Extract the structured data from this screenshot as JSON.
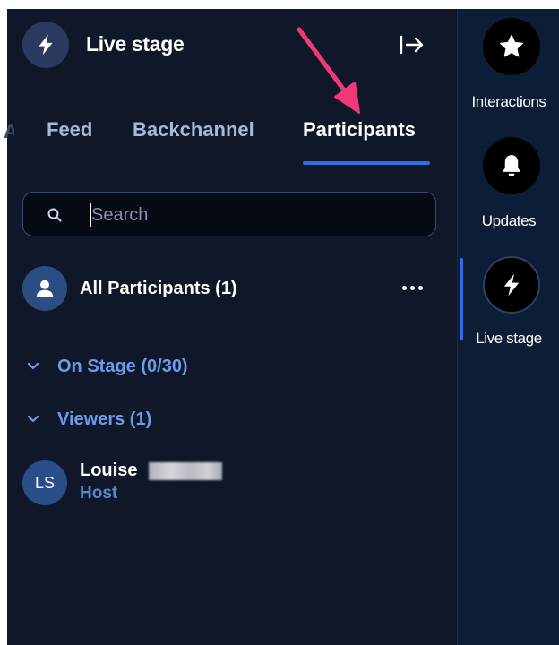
{
  "header": {
    "title": "Live stage",
    "avatar_icon": "lightning-icon",
    "collapse_icon": "collapse-right-icon"
  },
  "tabs": [
    {
      "label": "Feed",
      "active": false
    },
    {
      "label": "Backchannel",
      "active": false
    },
    {
      "label": "Participants",
      "active": true
    }
  ],
  "search": {
    "value": "",
    "placeholder": "Search",
    "icon": "search-icon"
  },
  "all_participants": {
    "label": "All Participants (1)",
    "icon": "user-icon",
    "more_icon": "more-horizontal-icon"
  },
  "sections": [
    {
      "label": "On Stage (0/30)",
      "expanded": true
    },
    {
      "label": "Viewers (1)",
      "expanded": true
    }
  ],
  "participants": [
    {
      "initials": "LS",
      "name": "Louise",
      "role": "Host"
    }
  ],
  "rail": {
    "items": [
      {
        "label": "Interactions",
        "icon": "star-icon",
        "active": false
      },
      {
        "label": "Updates",
        "icon": "bell-icon",
        "active": false
      },
      {
        "label": "Live stage",
        "icon": "lightning-icon",
        "active": true
      }
    ]
  },
  "colors": {
    "background": "#0f1729",
    "rail_background": "#0e1d36",
    "accent": "#2d6ee8",
    "section_text": "#6e9be6",
    "annotation_arrow": "#f0397a"
  }
}
